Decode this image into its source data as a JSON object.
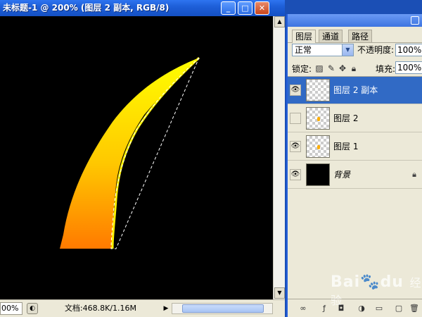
{
  "document": {
    "title": "未标题-1 @ 200% (图层 2 副本, RGB/8)",
    "minimize_glyph": "_",
    "maximize_glyph": "□",
    "close_glyph": "✕"
  },
  "statusbar": {
    "zoom": "00%",
    "doc_size": "文档:468.8K/1.16M",
    "arrow_glyph": "▶"
  },
  "layers_panel": {
    "tabs": [
      {
        "label": "图层"
      },
      {
        "label": "通道"
      },
      {
        "label": "路径"
      }
    ],
    "blend_mode": "正常",
    "opacity_label": "不透明度:",
    "opacity_value": "100%",
    "lock_label": "锁定:",
    "fill_label": "填充:",
    "fill_value": "100%",
    "layers": [
      {
        "name": "图层 2 副本",
        "visible": true,
        "selected": true
      },
      {
        "name": "图层 2",
        "visible": false,
        "selected": false
      },
      {
        "name": "图层 1",
        "visible": true,
        "selected": false
      },
      {
        "name": "背景",
        "visible": true,
        "selected": false,
        "locked": true
      }
    ]
  },
  "watermark": {
    "text": "Bai",
    "paw": "🐾",
    "text2": "du",
    "sub": "经验"
  },
  "colors": {
    "selection_blue": "#316ac5",
    "shape_top": "#ffff00",
    "shape_bottom": "#ff7a00"
  }
}
